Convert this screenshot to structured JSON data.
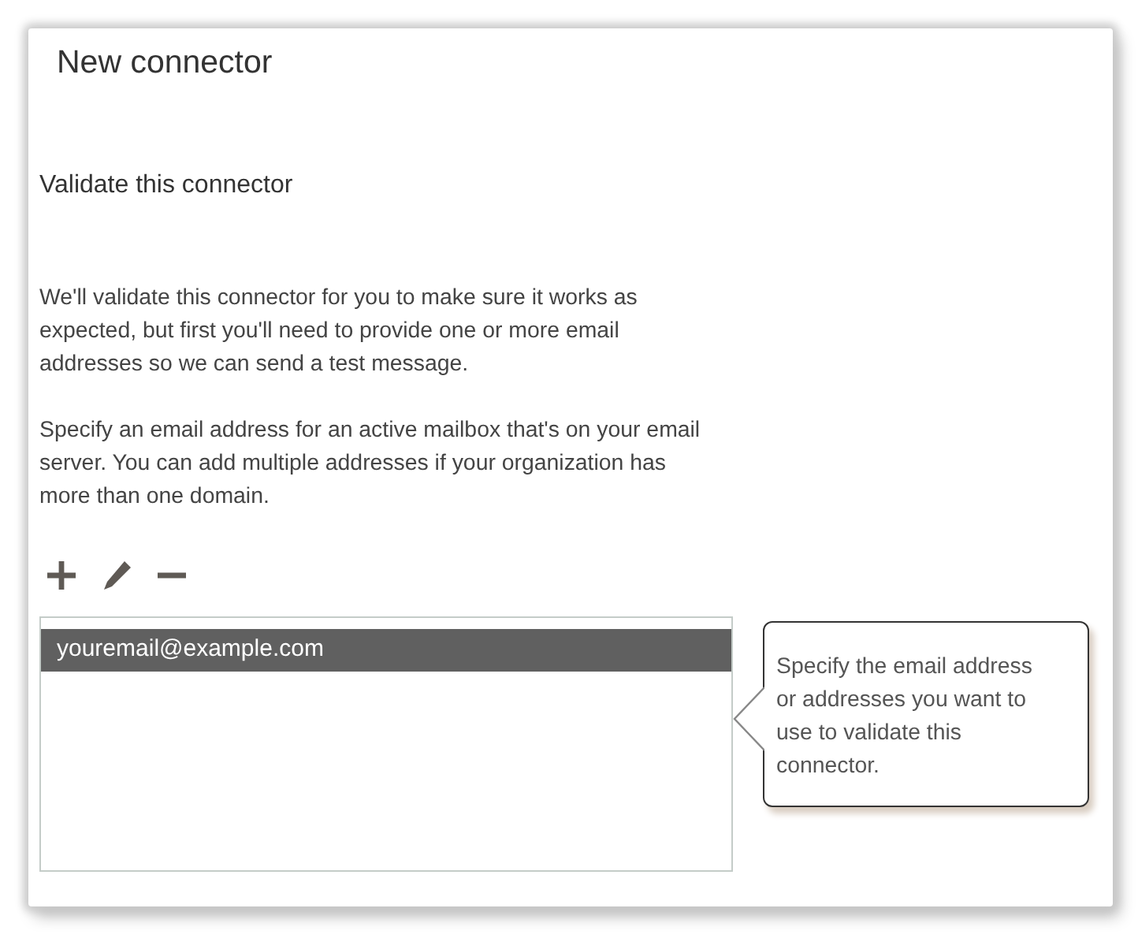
{
  "window": {
    "title": "New connector"
  },
  "heading": "Validate this connector",
  "paragraphs": [
    "We'll validate this connector for you to make sure it works as expected, but first you'll need to provide one or more email addresses so we can send a test message.",
    "Specify an email address for an active mailbox that's on your email server. You can add multiple addresses if your organization has more than one domain."
  ],
  "toolbar": [
    {
      "kind": "add"
    },
    {
      "kind": "edit"
    },
    {
      "kind": "remove"
    }
  ],
  "addresses": [
    {
      "label": "youremail@example.com",
      "selected": true
    }
  ],
  "callout": "Specify the email address or addresses you want to use to validate this connector."
}
